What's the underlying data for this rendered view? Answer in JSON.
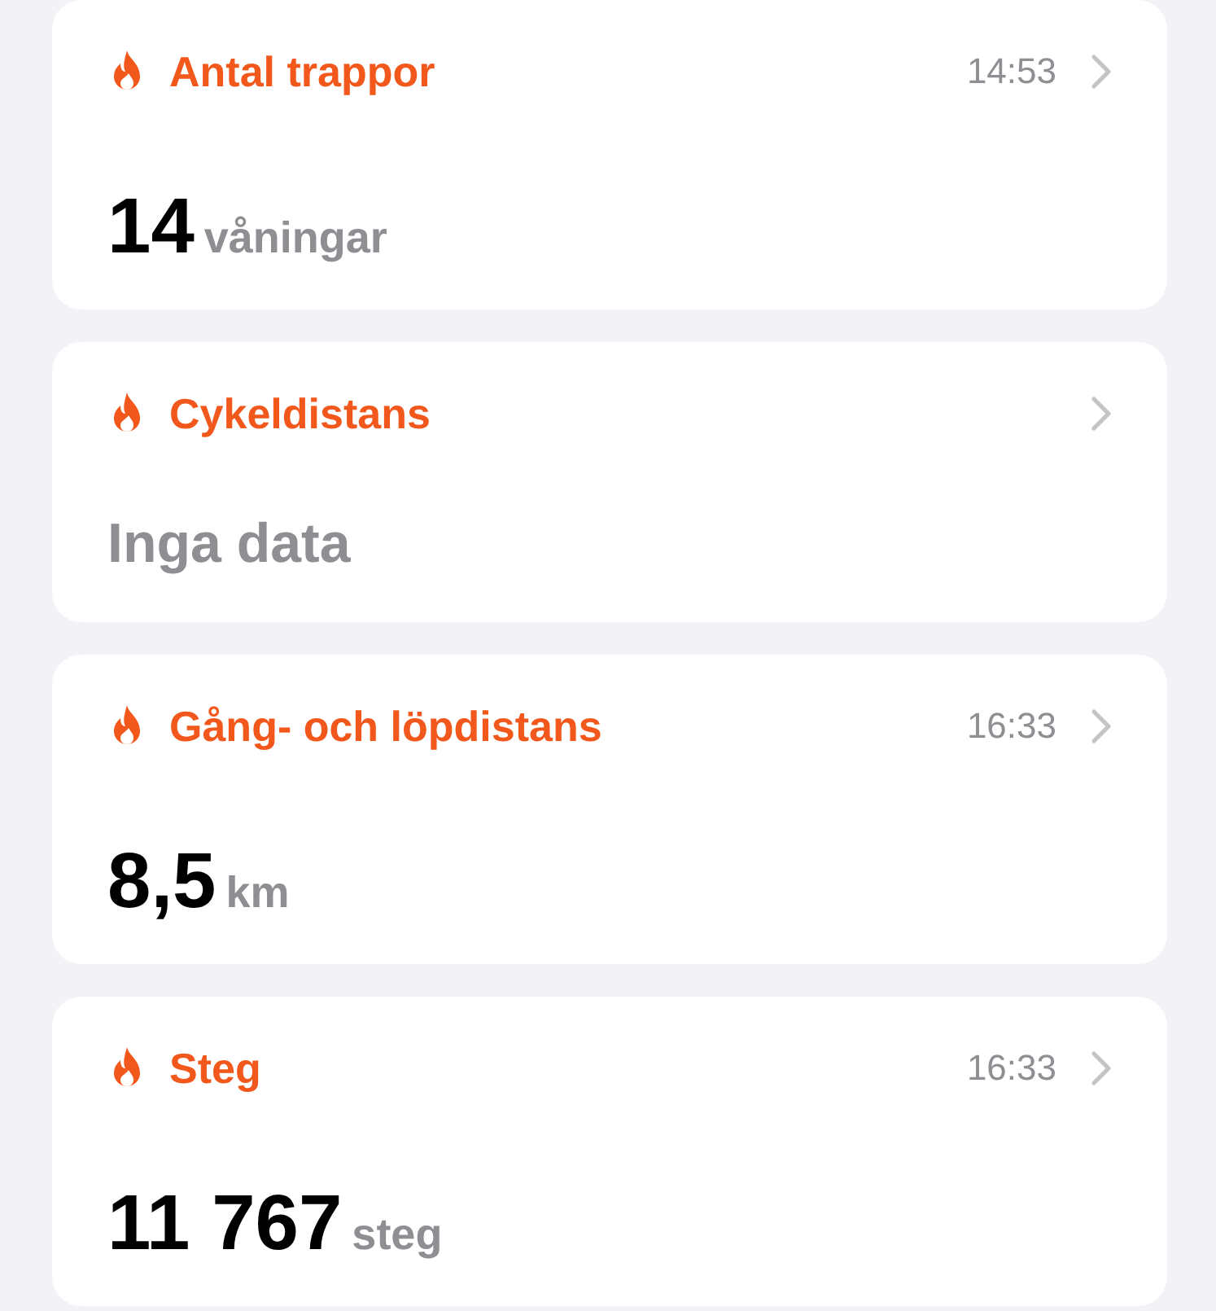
{
  "cards": [
    {
      "kind": "value",
      "title": "Antal trappor",
      "time": "14:53",
      "value": "14",
      "unit": "våningar"
    },
    {
      "kind": "empty",
      "title": "Cykeldistans",
      "value": "Inga data"
    },
    {
      "kind": "value",
      "title": "Gång- och löpdistans",
      "time": "16:33",
      "value": "8,5",
      "unit": "km"
    },
    {
      "kind": "value",
      "title": "Steg",
      "time": "16:33",
      "value": "11 767",
      "unit": "steg"
    }
  ]
}
